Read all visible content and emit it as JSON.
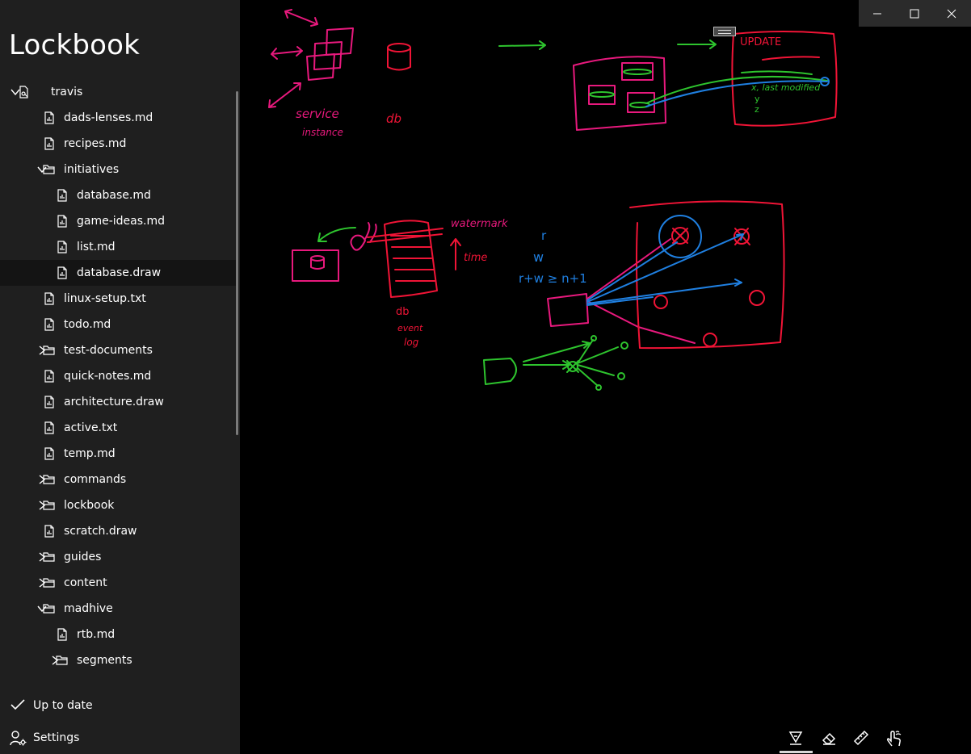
{
  "app": {
    "title": "Lockbook"
  },
  "tree": [
    {
      "label": "travis",
      "type": "account",
      "depth": 0,
      "expanded": true
    },
    {
      "label": "dads-lenses.md",
      "type": "file",
      "depth": 1
    },
    {
      "label": "recipes.md",
      "type": "file",
      "depth": 1
    },
    {
      "label": "initiatives",
      "type": "folder",
      "depth": 1,
      "expanded": true
    },
    {
      "label": "database.md",
      "type": "file",
      "depth": 2
    },
    {
      "label": "game-ideas.md",
      "type": "file",
      "depth": 2
    },
    {
      "label": "list.md",
      "type": "file",
      "depth": 2
    },
    {
      "label": "database.draw",
      "type": "file",
      "depth": 2,
      "selected": true
    },
    {
      "label": "linux-setup.txt",
      "type": "file",
      "depth": 1
    },
    {
      "label": "todo.md",
      "type": "file",
      "depth": 1
    },
    {
      "label": "test-documents",
      "type": "folder",
      "depth": 1,
      "expanded": false
    },
    {
      "label": "quick-notes.md",
      "type": "file",
      "depth": 1
    },
    {
      "label": "architecture.draw",
      "type": "file",
      "depth": 1
    },
    {
      "label": "active.txt",
      "type": "file",
      "depth": 1
    },
    {
      "label": "temp.md",
      "type": "file",
      "depth": 1
    },
    {
      "label": "commands",
      "type": "folder",
      "depth": 1,
      "expanded": false
    },
    {
      "label": "lockbook",
      "type": "folder",
      "depth": 1,
      "expanded": false
    },
    {
      "label": "scratch.draw",
      "type": "file",
      "depth": 1
    },
    {
      "label": "guides",
      "type": "folder",
      "depth": 1,
      "expanded": false
    },
    {
      "label": "content",
      "type": "folder",
      "depth": 1,
      "expanded": false
    },
    {
      "label": "madhive",
      "type": "folder",
      "depth": 1,
      "expanded": true
    },
    {
      "label": "rtb.md",
      "type": "file",
      "depth": 2
    },
    {
      "label": "segments",
      "type": "folder",
      "depth": 2,
      "expanded": false
    }
  ],
  "footer": {
    "sync_status": "Up to date",
    "settings_label": "Settings"
  },
  "drawing": {
    "labels": {
      "service_instance": "service instance",
      "db_top": "db",
      "update": "UPDATE",
      "x_last_modified": "x, last modified",
      "y": "y",
      "z": "z",
      "watermark": "watermark",
      "time": "time",
      "db_event_log": "db event log",
      "r": "r",
      "w": "w",
      "quorum": "r+w ≥ n+1"
    }
  },
  "toolbar": {
    "active_tool": "pen",
    "tools": [
      "pen-icon",
      "eraser-icon",
      "ruler-icon",
      "touch-icon"
    ]
  },
  "colors": {
    "sidebar_bg": "#1f1f1f",
    "canvas_bg": "#000000",
    "ink_magenta": "#e8197d",
    "ink_red": "#f01436",
    "ink_green": "#2ec42e",
    "ink_blue": "#1f7fe0"
  }
}
